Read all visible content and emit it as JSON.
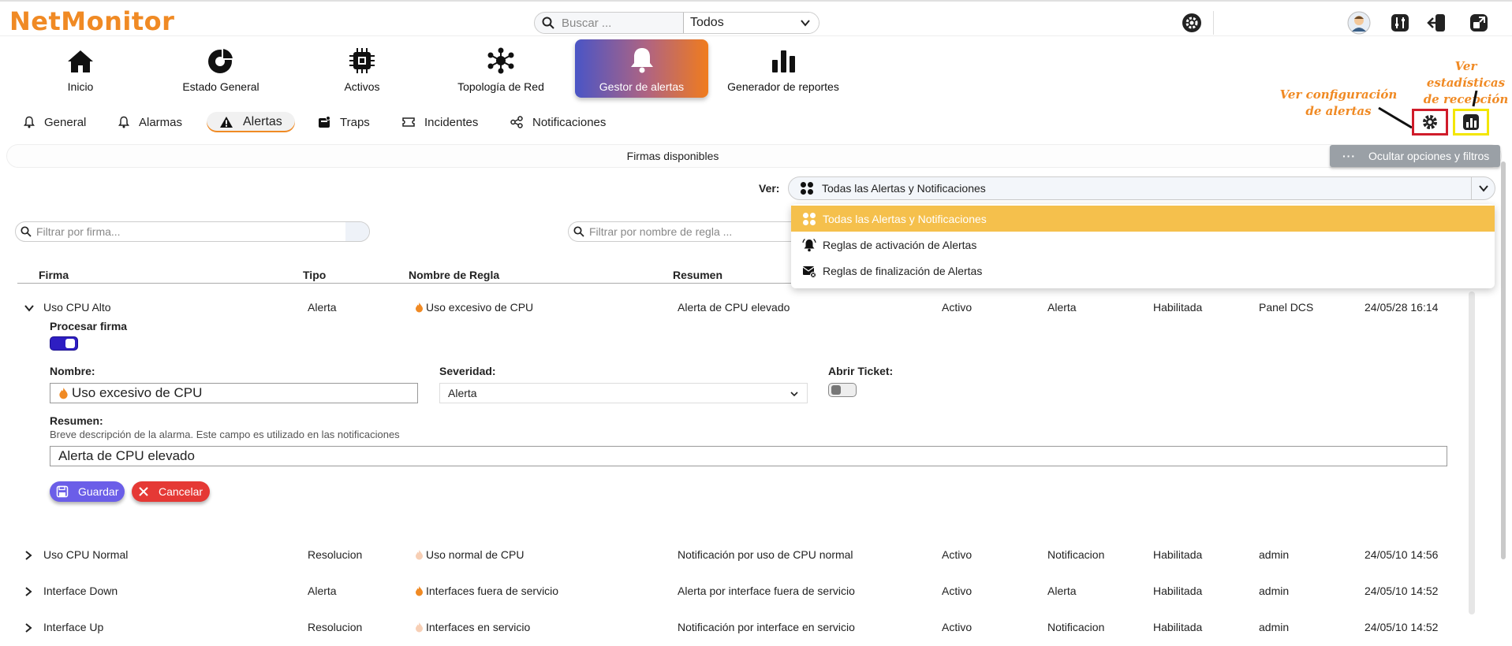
{
  "app": {
    "logo": "NetMonitor"
  },
  "search": {
    "placeholder": "Buscar ...",
    "scope": "Todos"
  },
  "nav": {
    "items": [
      {
        "label": "Inicio",
        "icon": "home-icon"
      },
      {
        "label": "Estado General",
        "icon": "pie-chart-icon"
      },
      {
        "label": "Activos",
        "icon": "chip-icon"
      },
      {
        "label": "Topología de Red",
        "icon": "network-icon"
      },
      {
        "label": "Gestor de alertas",
        "icon": "bell-icon",
        "active": true
      },
      {
        "label": "Generador de reportes",
        "icon": "bar-chart-icon"
      }
    ]
  },
  "subtabs": [
    {
      "label": "General",
      "icon": "bell-icon"
    },
    {
      "label": "Alarmas",
      "icon": "bell-icon"
    },
    {
      "label": "Alertas",
      "icon": "warning-icon",
      "active": true
    },
    {
      "label": "Traps",
      "icon": "trap-icon"
    },
    {
      "label": "Incidentes",
      "icon": "ticket-icon"
    },
    {
      "label": "Notificaciones",
      "icon": "share-icon"
    }
  ],
  "annotations": {
    "config": "Ver configuración de alertas",
    "stats": "Ver estadísticas de recepción"
  },
  "panel": {
    "title": "Firmas disponibles",
    "hide_button": "Ocultar opciones y filtros",
    "ver_label": "Ver:",
    "ver_value": "Todas las Alertas y Notificaciones",
    "dropdown_options": [
      "Todas las Alertas y Notificaciones",
      "Reglas de activación de Alertas",
      "Reglas de finalización de Alertas"
    ],
    "filter_firma_placeholder": "Filtrar por firma...",
    "filter_regla_placeholder": "Filtrar por nombre de regla ..."
  },
  "table": {
    "headers": [
      "Firma",
      "Tipo",
      "Nombre de Regla",
      "Resumen"
    ],
    "rows": [
      [
        "Uso CPU Alto",
        "Alerta",
        "Uso excesivo de CPU",
        "Alerta de CPU elevado",
        "Activo",
        "Alerta",
        "Habilitada",
        "Panel DCS",
        "24/05/28 16:14"
      ],
      [
        "Uso CPU Normal",
        "Resolucion",
        "Uso normal de CPU",
        "Notificación por uso de CPU normal",
        "Activo",
        "Notificacion",
        "Habilitada",
        "admin",
        "24/05/10 14:56"
      ],
      [
        "Interface Down",
        "Alerta",
        "Interfaces fuera de servicio",
        "Alerta por interface fuera de servicio",
        "Activo",
        "Alerta",
        "Habilitada",
        "admin",
        "24/05/10 14:52"
      ],
      [
        "Interface Up",
        "Resolucion",
        "Interfaces en servicio",
        "Notificación por interface en servicio",
        "Activo",
        "Notificacion",
        "Habilitada",
        "admin",
        "24/05/10 14:52"
      ]
    ]
  },
  "form": {
    "procesar_label": "Procesar firma",
    "nombre_label": "Nombre:",
    "nombre_value": "Uso excesivo de CPU",
    "severidad_label": "Severidad:",
    "severidad_value": "Alerta",
    "ticket_label": "Abrir Ticket:",
    "resumen_label": "Resumen:",
    "resumen_help": "Breve descripción de la alarma. Este campo es utilizado en las notificaciones",
    "resumen_value": "Alerta de CPU elevado",
    "save_label": "Guardar",
    "cancel_label": "Cancelar"
  },
  "colors": {
    "brand": "#f08a24",
    "selected_option": "#f5c04c",
    "save_button": "#6b5ee8",
    "cancel_button": "#e53935",
    "toggle_on": "#2e1ec2"
  }
}
